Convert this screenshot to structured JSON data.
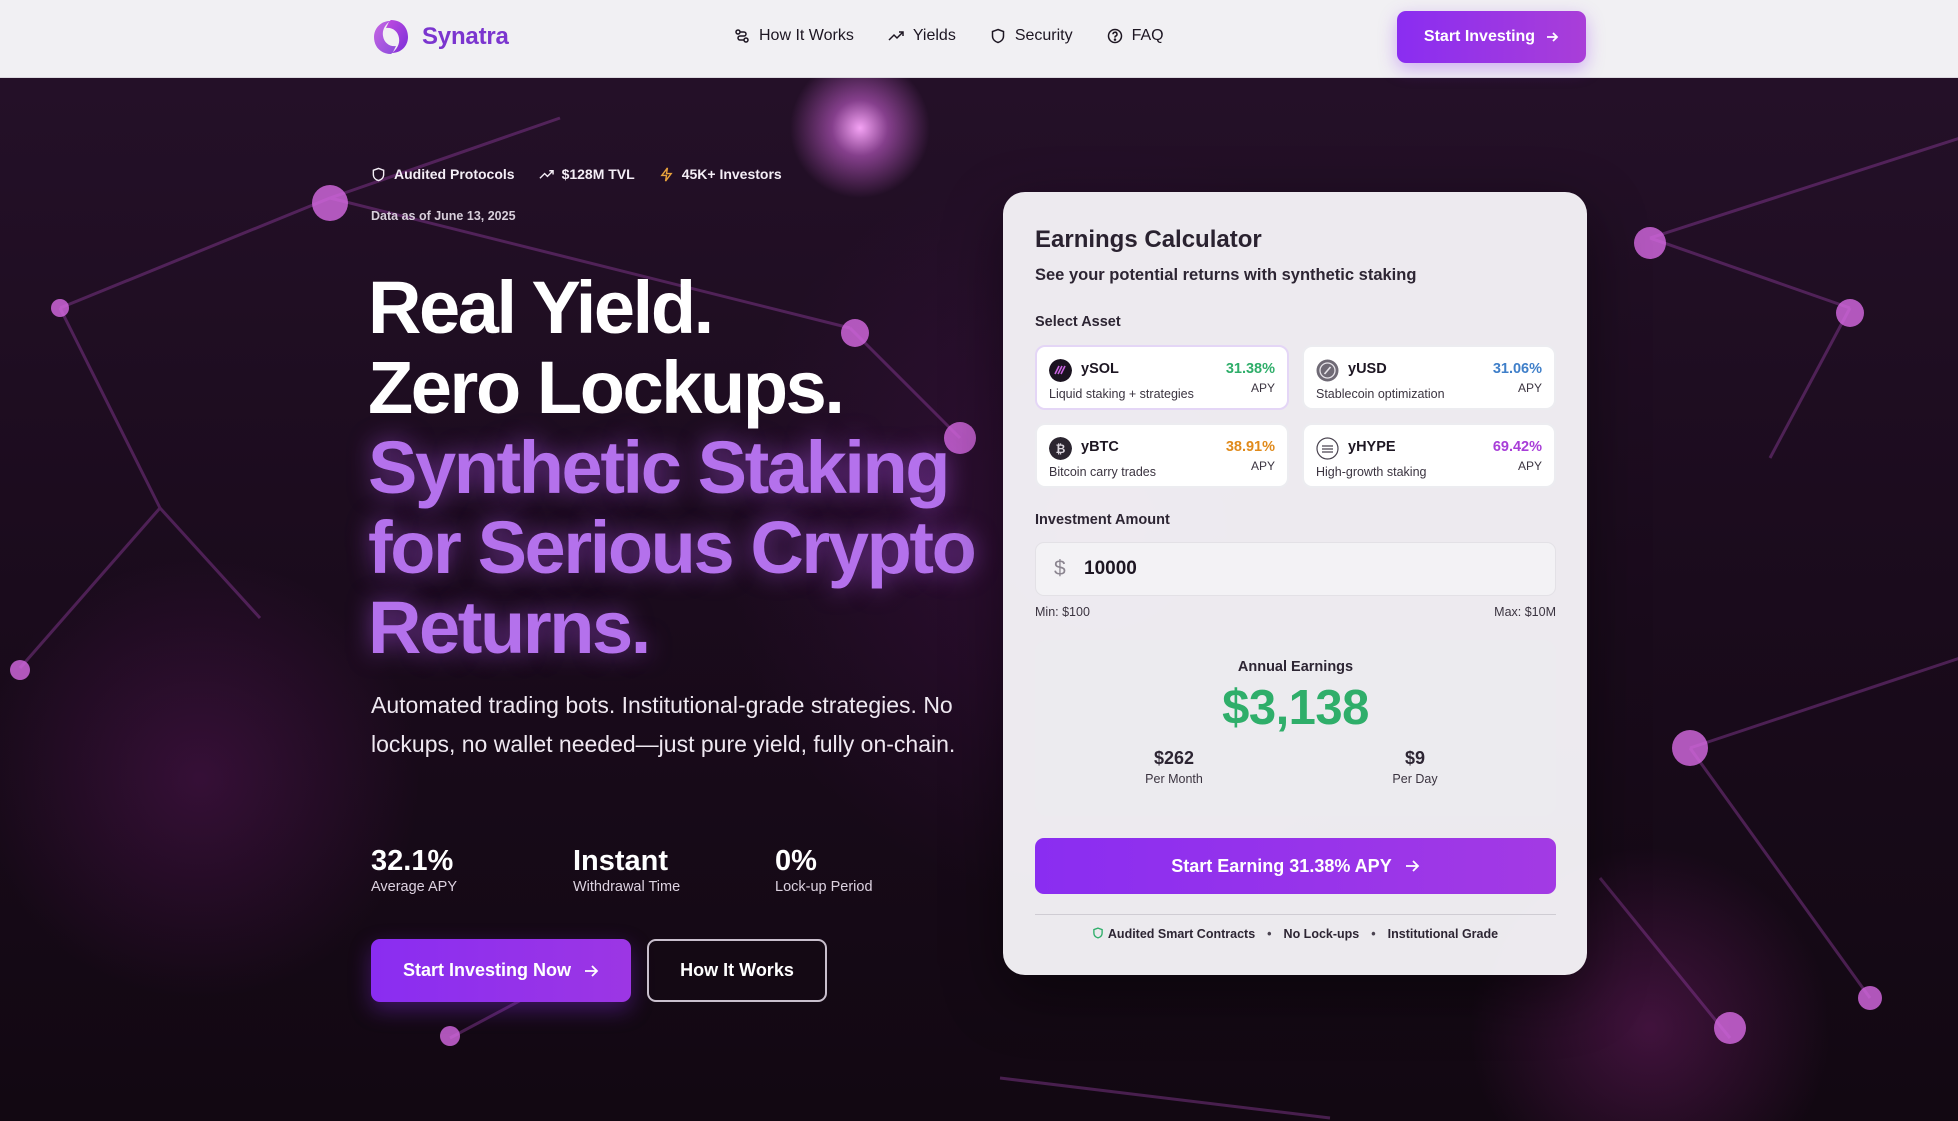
{
  "header": {
    "brand": "Synatra",
    "nav": [
      {
        "label": "How It Works",
        "icon": "route-icon"
      },
      {
        "label": "Yields",
        "icon": "trending-up-icon"
      },
      {
        "label": "Security",
        "icon": "shield-icon"
      },
      {
        "label": "FAQ",
        "icon": "help-circle-icon"
      }
    ],
    "cta_label": "Start Investing"
  },
  "hero": {
    "badges": [
      {
        "label": "Audited Protocols",
        "icon": "shield-icon"
      },
      {
        "label": "$128M TVL",
        "icon": "trending-up-icon"
      },
      {
        "label": "45K+ Investors",
        "icon": "zap-icon"
      }
    ],
    "data_date": "Data as of June 13, 2025",
    "headline": {
      "line1": "Real Yield.",
      "line2": "Zero Lockups.",
      "line3": "Synthetic Staking",
      "line4": "for Serious Crypto",
      "line5": "Returns."
    },
    "subtitle": "Automated trading bots. Institutional-grade strategies. No lockups, no wallet needed—just pure yield, fully on-chain.",
    "stats": [
      {
        "value": "32.1%",
        "label": "Average APY"
      },
      {
        "value": "Instant",
        "label": "Withdrawal Time"
      },
      {
        "value": "0%",
        "label": "Lock-up Period"
      }
    ],
    "primary_button": "Start Investing Now",
    "secondary_button": "How It Works"
  },
  "calculator": {
    "title": "Earnings Calculator",
    "subtitle": "See your potential returns with synthetic staking",
    "select_label": "Select Asset",
    "assets": [
      {
        "name": "ySOL",
        "desc": "Liquid staking + strategies",
        "apy": "31.38%",
        "apy_label": "APY",
        "color": "#2fae6a",
        "icon": "solana-icon",
        "selected": true
      },
      {
        "name": "yUSD",
        "desc": "Stablecoin optimization",
        "apy": "31.06%",
        "apy_label": "APY",
        "color": "#3f7fc9",
        "icon": "usd-coin-icon",
        "selected": false
      },
      {
        "name": "yBTC",
        "desc": "Bitcoin carry trades",
        "apy": "38.91%",
        "apy_label": "APY",
        "color": "#e08a1b",
        "icon": "bitcoin-icon",
        "selected": false
      },
      {
        "name": "yHYPE",
        "desc": "High-growth staking",
        "apy": "69.42%",
        "apy_label": "APY",
        "color": "#a83ed8",
        "icon": "hype-icon",
        "selected": false
      }
    ],
    "amount_label": "Investment Amount",
    "currency_symbol": "$",
    "amount_value": "10000",
    "min_label": "Min: $100",
    "max_label": "Max: $10M",
    "annual_label": "Annual Earnings",
    "annual_value": "$3,138",
    "per_month_value": "$262",
    "per_month_label": "Per Month",
    "per_day_value": "$9",
    "per_day_label": "Per Day",
    "cta_label": "Start Earning 31.38% APY",
    "trust": [
      "Audited Smart Contracts",
      "No Lock-ups",
      "Institutional Grade"
    ],
    "trust_separator": "•"
  },
  "colors": {
    "accent": "#8a2df1",
    "brand": "#7b35cf",
    "earnings_green": "#2fae6a",
    "headline_purple": "#b471ec"
  }
}
